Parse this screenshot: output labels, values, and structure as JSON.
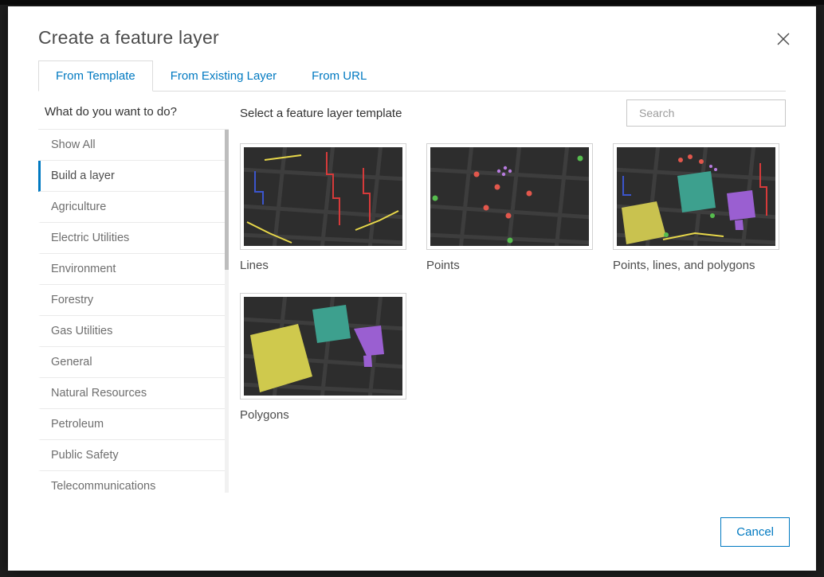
{
  "colors": {
    "accent_blue": "#0079c1",
    "title_gray": "#4c4c4c"
  },
  "dialog": {
    "title": "Create a feature layer"
  },
  "tabs": [
    {
      "label": "From Template",
      "active": true
    },
    {
      "label": "From Existing Layer",
      "active": false
    },
    {
      "label": "From URL",
      "active": false
    }
  ],
  "sidebar": {
    "heading": "What do you want to do?",
    "selected_index": 1,
    "items": [
      "Show All",
      "Build a layer",
      "Agriculture",
      "Electric Utilities",
      "Environment",
      "Forestry",
      "Gas Utilities",
      "General",
      "Natural Resources",
      "Petroleum",
      "Public Safety",
      "Telecommunications"
    ]
  },
  "main": {
    "heading": "Select a feature layer template",
    "search": {
      "placeholder": "Search",
      "value": ""
    },
    "templates": [
      {
        "label": "Lines"
      },
      {
        "label": "Points"
      },
      {
        "label": "Points, lines, and polygons"
      },
      {
        "label": "Polygons"
      }
    ]
  },
  "footer": {
    "cancel_label": "Cancel"
  },
  "icons": [
    "search-icon",
    "close-icon"
  ]
}
